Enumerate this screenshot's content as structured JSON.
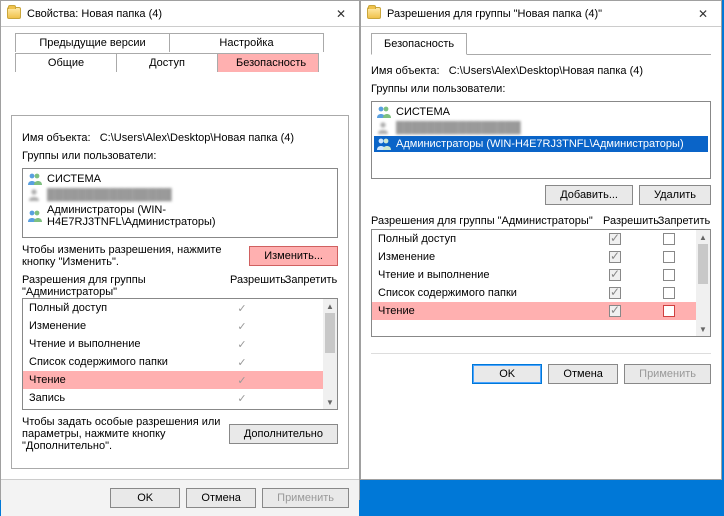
{
  "win1": {
    "title": "Свойства: Новая папка (4)",
    "tabs": {
      "prev": "Предыдущие версии",
      "settings": "Настройка",
      "general": "Общие",
      "access": "Доступ",
      "security": "Безопасность"
    },
    "obj_label": "Имя объекта:",
    "obj_path": "C:\\Users\\Alex\\Desktop\\Новая папка (4)",
    "groups_label": "Группы или пользователи:",
    "groups": {
      "system": "СИСТЕМА",
      "admins": "Администраторы (WIN-H4E7RJ3TNFL\\Администраторы)"
    },
    "edit_hint": "Чтобы изменить разрешения, нажмите кнопку \"Изменить\".",
    "edit_btn": "Изменить...",
    "perm_for": "Разрешения для группы \"Администраторы\"",
    "col_allow": "Разрешить",
    "col_deny": "Запретить",
    "perms": {
      "full": "Полный доступ",
      "modify": "Изменение",
      "readexec": "Чтение и выполнение",
      "list": "Список содержимого папки",
      "read": "Чтение",
      "write": "Запись"
    },
    "adv_hint": "Чтобы задать особые разрешения или параметры, нажмите кнопку \"Дополнительно\".",
    "adv_btn": "Дополнительно",
    "ok": "OK",
    "cancel": "Отмена",
    "apply": "Применить"
  },
  "win2": {
    "title": "Разрешения для группы \"Новая папка (4)\"",
    "tab_security": "Безопасность",
    "obj_label": "Имя объекта:",
    "obj_path": "C:\\Users\\Alex\\Desktop\\Новая папка (4)",
    "groups_label": "Группы или пользователи:",
    "groups": {
      "system": "СИСТЕМА",
      "admins": "Администраторы (WIN-H4E7RJ3TNFL\\Администраторы)"
    },
    "add_btn": "Добавить...",
    "del_btn": "Удалить",
    "perm_for": "Разрешения для группы \"Администраторы\"",
    "col_allow": "Разрешить",
    "col_deny": "Запретить",
    "perms": {
      "full": "Полный доступ",
      "modify": "Изменение",
      "readexec": "Чтение и выполнение",
      "list": "Список содержимого папки",
      "read": "Чтение"
    },
    "ok": "OK",
    "cancel": "Отмена",
    "apply": "Применить"
  }
}
